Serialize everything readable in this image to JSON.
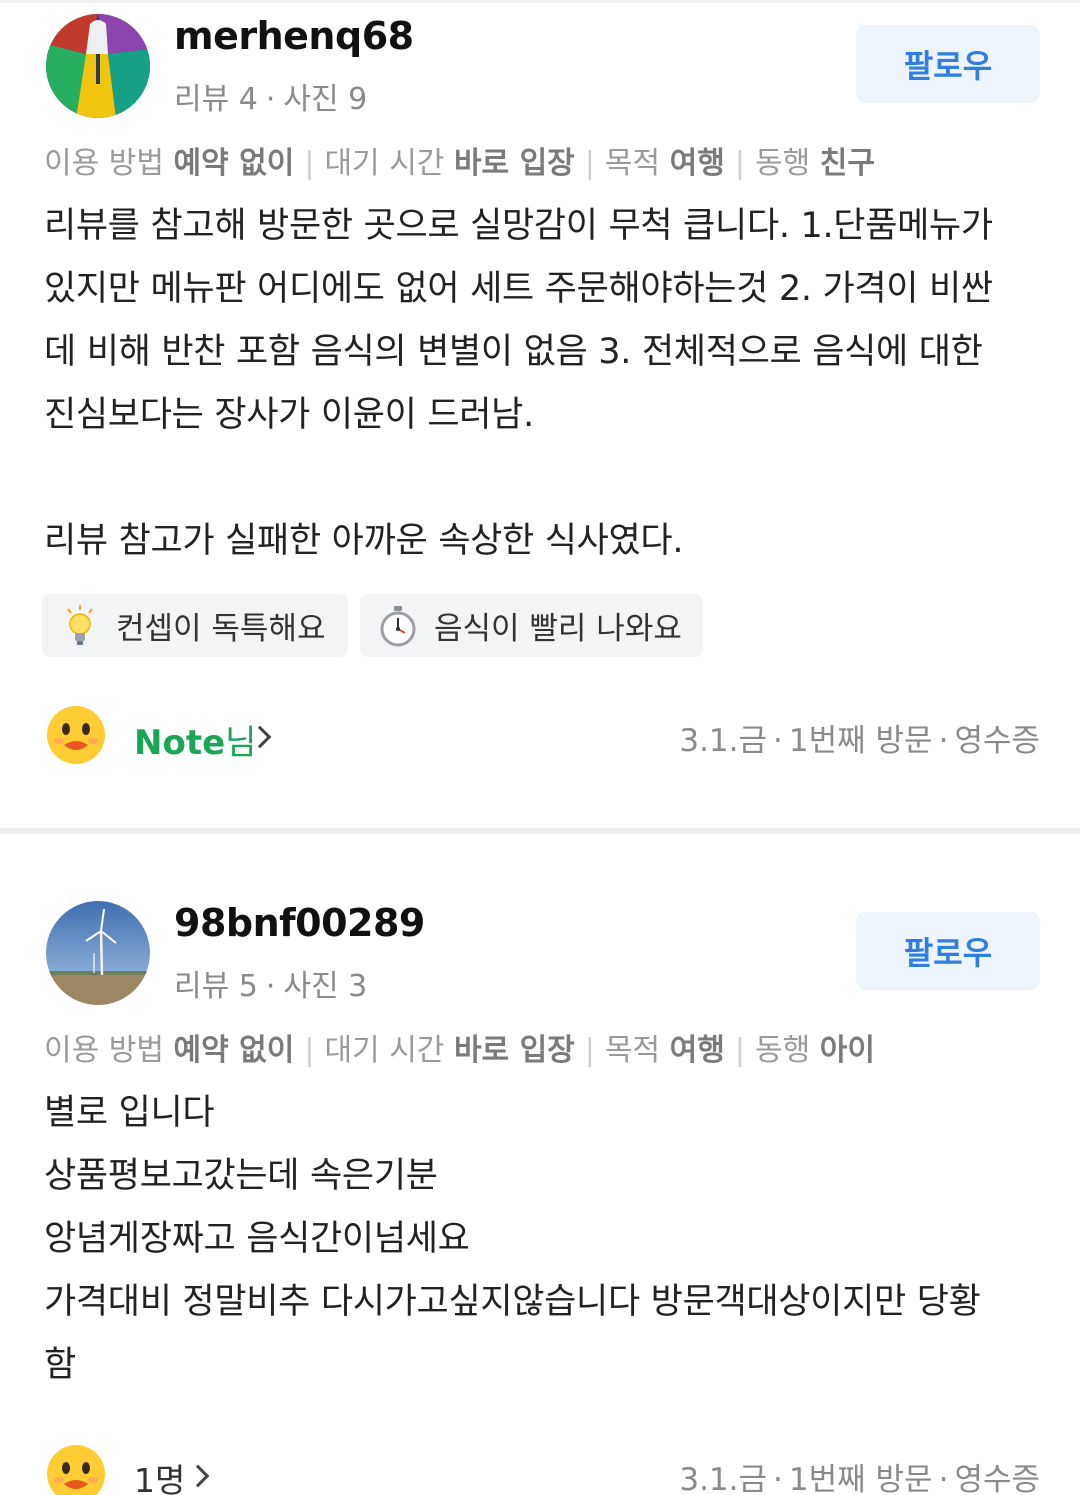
{
  "reviews": [
    {
      "username": "merhenq68",
      "stats": {
        "reviews": "리뷰 4",
        "photos": "사진 9"
      },
      "follow_label": "팔로우",
      "meta": {
        "method_label": "이용 방법",
        "method_value": "예약 없이",
        "wait_label": "대기 시간",
        "wait_value": "바로 입장",
        "purpose_label": "목적",
        "purpose_value": "여행",
        "companion_label": "동행",
        "companion_value": "친구"
      },
      "body_lines": [
        "리뷰를 참고해 방문한 곳으로 실망감이 무척 큽니다. 1.단품메뉴가",
        "있지만 메뉴판 어디에도 없어 세트 주문해야하는것 2. 가격이 비싼",
        "데 비해 반찬 포함 음식의 변별이 없음 3. 전체적으로 음식에 대한",
        "진심보다는 장사가 이윤이 드러남.",
        "",
        "리뷰 참고가 실패한 아까운 속상한 식사였다."
      ],
      "tags": [
        {
          "icon": "lightbulb-icon",
          "label": "컨셉이 독특해요"
        },
        {
          "icon": "stopwatch-icon",
          "label": "음식이 빨리 나와요"
        }
      ],
      "owner_reply": {
        "name": "Note",
        "suffix": "님"
      },
      "visit": {
        "date": "3.1.금",
        "count": "1번째 방문",
        "verify": "영수증"
      }
    },
    {
      "username": "98bnf00289",
      "stats": {
        "reviews": "리뷰 5",
        "photos": "사진 3"
      },
      "follow_label": "팔로우",
      "meta": {
        "method_label": "이용 방법",
        "method_value": "예약 없이",
        "wait_label": "대기 시간",
        "wait_value": "바로 입장",
        "purpose_label": "목적",
        "purpose_value": "여행",
        "companion_label": "동행",
        "companion_value": "아이"
      },
      "body_lines": [
        "별로 입니다",
        "상품평보고갔는데 속은기분",
        "앙념게장짜고 음식간이넘세요",
        "가격대비 정말비추 다시가고싶지않습니다 방문객대상이지만 당황",
        "함"
      ],
      "reaction": {
        "count": "1명"
      },
      "visit": {
        "date": "3.1.금",
        "count": "1번째 방문",
        "verify": "영수증"
      }
    }
  ]
}
